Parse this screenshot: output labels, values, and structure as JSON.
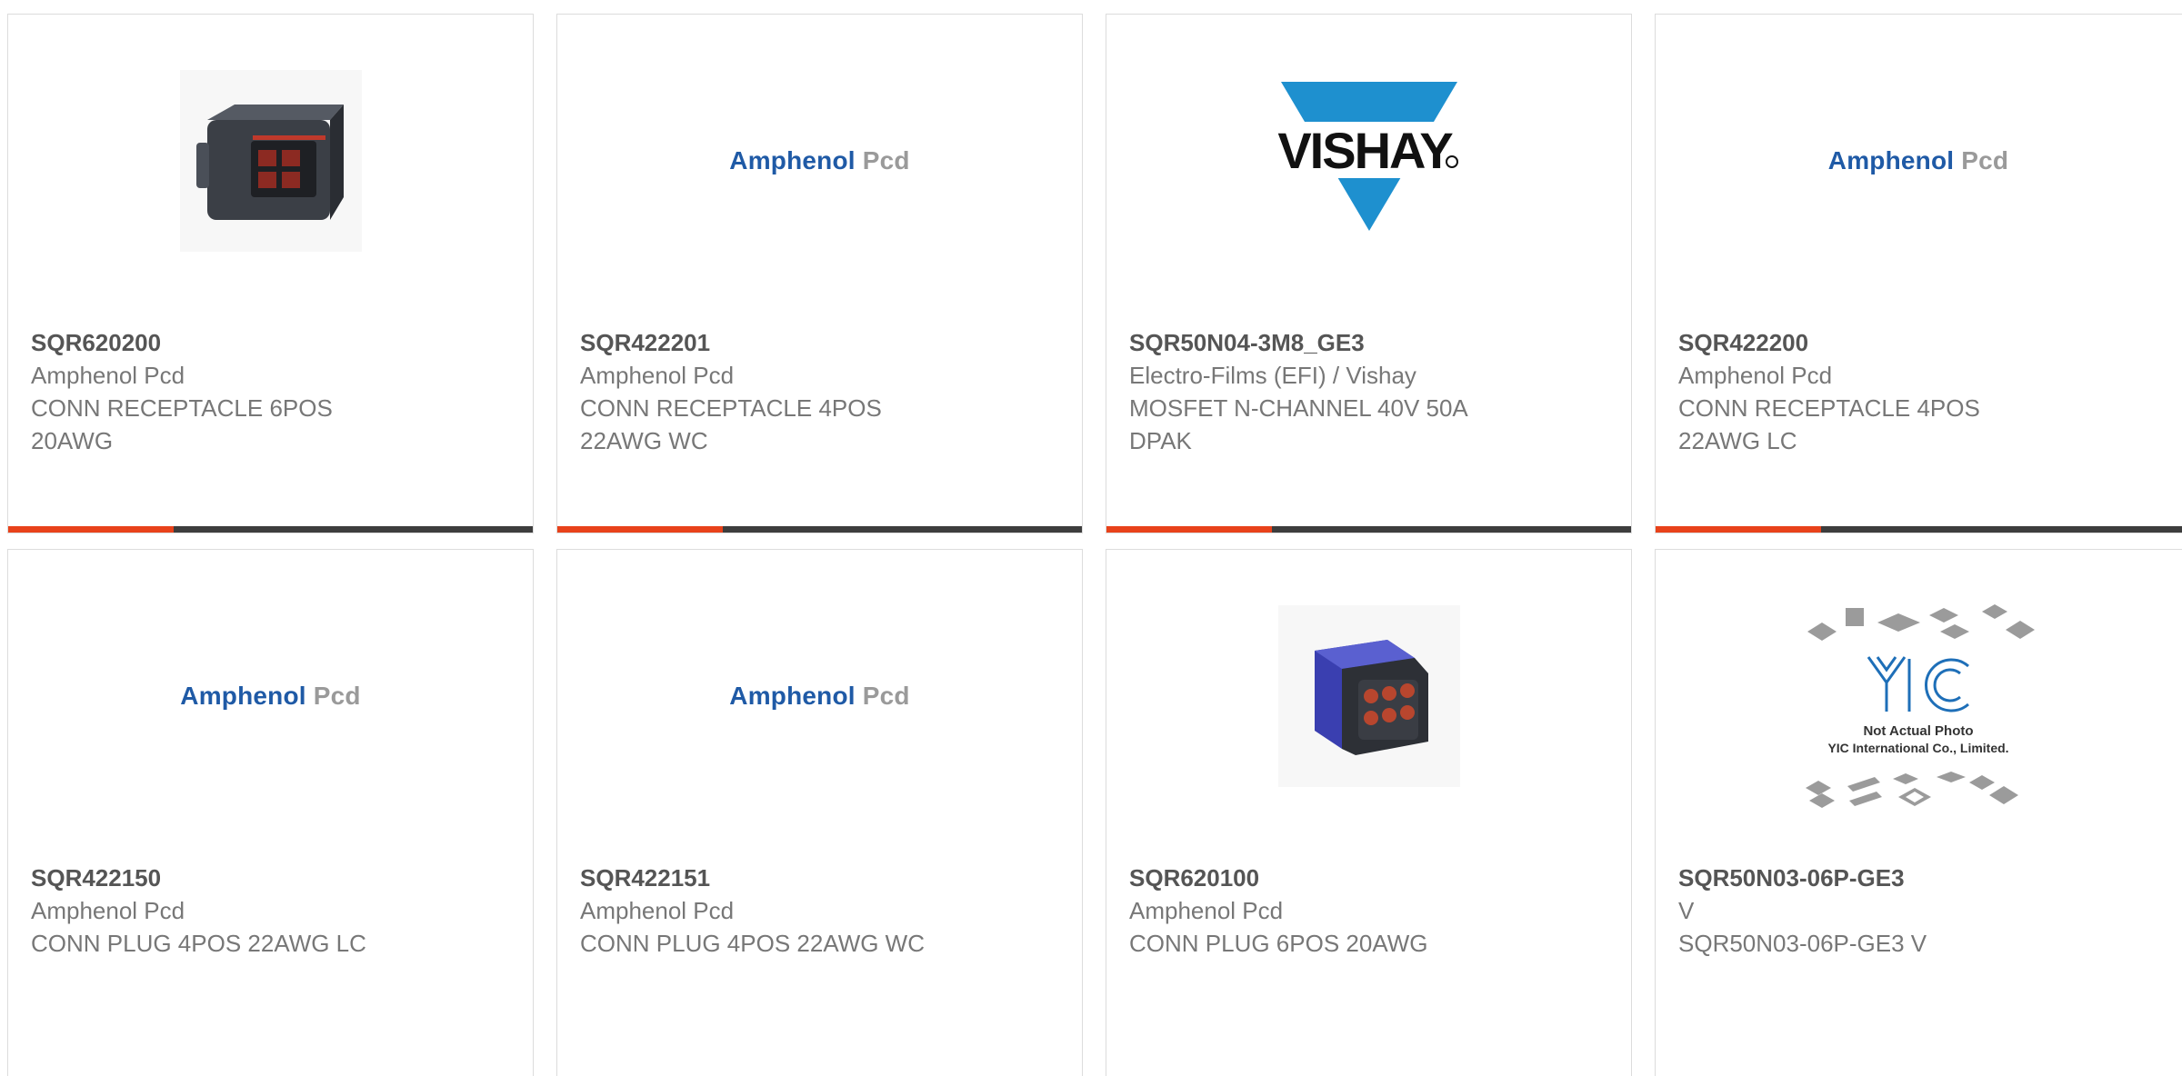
{
  "products": [
    {
      "part": "SQR620200",
      "manufacturer": "Amphenol Pcd",
      "description": "CONN RECEPTACLE 6POS\n20AWG",
      "image": "connector-receptacle-photo"
    },
    {
      "part": "SQR422201",
      "manufacturer": "Amphenol Pcd",
      "description": "CONN RECEPTACLE 4POS\n22AWG WC",
      "image": "amphenol-pcd-logo",
      "logo_a": "Amphenol",
      "logo_b": "Pcd"
    },
    {
      "part": "SQR50N04-3M8_GE3",
      "manufacturer": "Electro-Films (EFI) / Vishay",
      "description": "MOSFET N-CHANNEL 40V 50A\nDPAK",
      "image": "vishay-logo",
      "logo_text": "VISHAY"
    },
    {
      "part": "SQR422200",
      "manufacturer": "Amphenol Pcd",
      "description": "CONN RECEPTACLE 4POS\n22AWG LC",
      "image": "amphenol-pcd-logo",
      "logo_a": "Amphenol",
      "logo_b": "Pcd"
    },
    {
      "part": "SQR422150",
      "manufacturer": "Amphenol Pcd",
      "description": "CONN PLUG 4POS 22AWG LC",
      "image": "amphenol-pcd-logo",
      "logo_a": "Amphenol",
      "logo_b": "Pcd"
    },
    {
      "part": "SQR422151",
      "manufacturer": "Amphenol Pcd",
      "description": "CONN PLUG 4POS 22AWG WC",
      "image": "amphenol-pcd-logo",
      "logo_a": "Amphenol",
      "logo_b": "Pcd"
    },
    {
      "part": "SQR620100",
      "manufacturer": "Amphenol Pcd",
      "description": "CONN PLUG 6POS 20AWG",
      "image": "connector-plug-photo"
    },
    {
      "part": "SQR50N03-06P-GE3",
      "manufacturer": "V",
      "description": "SQR50N03-06P-GE3 V",
      "image": "yic-placeholder",
      "placeholder_line1": "Not Actual Photo",
      "placeholder_line2": "YIC International Co., Limited."
    }
  ],
  "colors": {
    "accent": "#e8421a",
    "bar": "#3d3d3d",
    "amphenol_blue": "#1f5aa6",
    "vishay_blue": "#1e90cf"
  }
}
